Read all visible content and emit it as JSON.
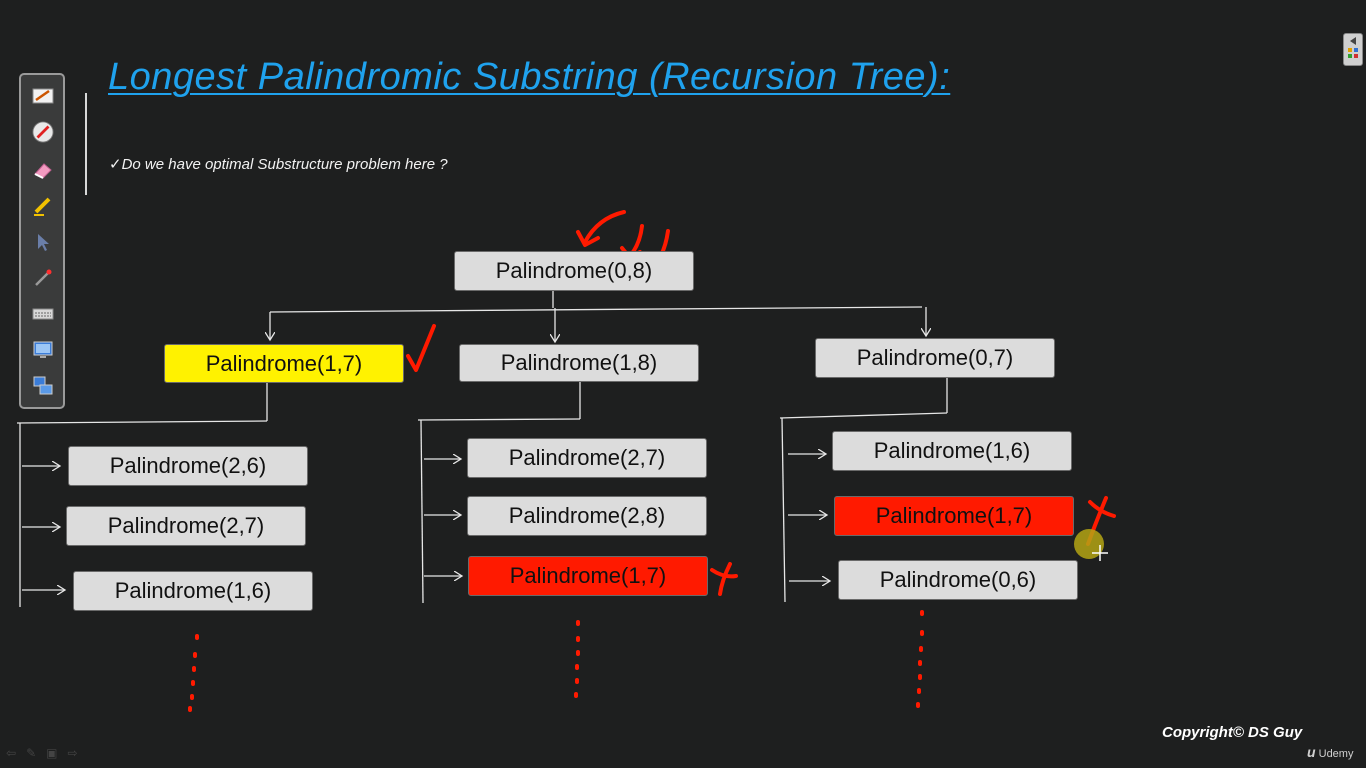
{
  "slide": {
    "title": "Longest Palindromic Substring (Recursion Tree):",
    "question": "✓Do we have optimal Substructure problem here ?",
    "copyright": "Copyright© DS Guy",
    "brand": "Udemy"
  },
  "tree": {
    "root": "Palindrome(0,8)",
    "level1": [
      "Palindrome(1,7)",
      "Palindrome(1,8)",
      "Palindrome(0,7)"
    ],
    "children_a": [
      "Palindrome(2,6)",
      "Palindrome(2,7)",
      "Palindrome(1,6)"
    ],
    "children_b": [
      "Palindrome(2,7)",
      "Palindrome(2,8)",
      "Palindrome(1,7)"
    ],
    "children_c": [
      "Palindrome(1,6)",
      "Palindrome(1,7)",
      "Palindrome(0,6)"
    ]
  },
  "colors": {
    "title": "#1fa2ee",
    "background": "#1e1f1f",
    "node": "#dcdcdc",
    "highlight_yellow": "#fff200",
    "highlight_red": "#ff1a00",
    "ink_red": "#ff1a00"
  },
  "toolbar": {
    "tools": [
      "pen-tool-icon",
      "ballpoint-pen-icon",
      "eraser-icon",
      "highlighter-icon",
      "pointer-arrow-icon",
      "laser-pointer-icon",
      "keyboard-icon",
      "screen-icon",
      "screen-switch-icon"
    ]
  },
  "footer_nav": {
    "icons": [
      "back-arrow-icon",
      "pen-icon",
      "screen-icon",
      "forward-arrow-icon"
    ]
  }
}
